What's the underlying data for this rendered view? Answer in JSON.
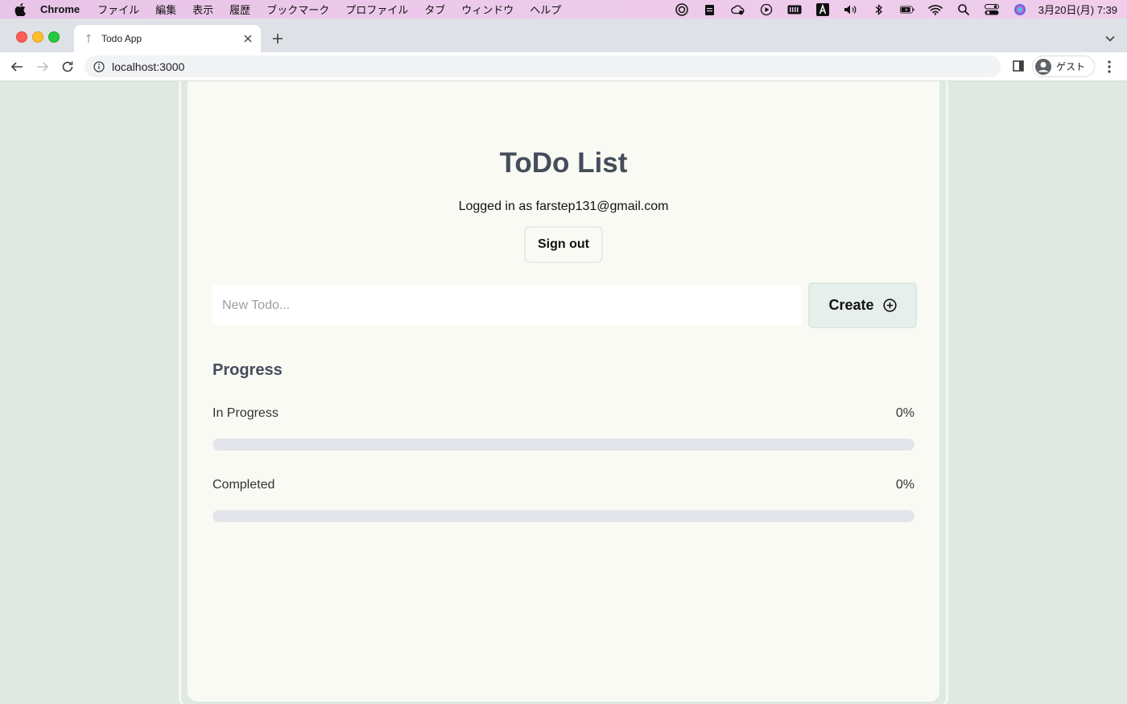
{
  "menubar": {
    "app_name": "Chrome",
    "items": [
      "ファイル",
      "編集",
      "表示",
      "履歴",
      "ブックマーク",
      "プロファイル",
      "タブ",
      "ウィンドウ",
      "ヘルプ"
    ],
    "clock": "3月20日(月)  7:39"
  },
  "browser": {
    "tab_title": "Todo App",
    "url": "localhost:3000",
    "profile_label": "ゲスト"
  },
  "page": {
    "title": "ToDo List",
    "logged_in_text": "Logged in as farstep131@gmail.com",
    "sign_out_label": "Sign out",
    "new_todo_placeholder": "New Todo...",
    "create_label": "Create",
    "progress_heading": "Progress",
    "progress": [
      {
        "label": "In Progress",
        "percent_text": "0%",
        "value": 0
      },
      {
        "label": "Completed",
        "percent_text": "0%",
        "value": 0
      }
    ]
  },
  "colors": {
    "page_bg": "#dfe8e1",
    "card_bg": "#fafaf4",
    "heading": "#454d5b",
    "track": "#e4e5ea",
    "create_bg": "#e7efec"
  }
}
